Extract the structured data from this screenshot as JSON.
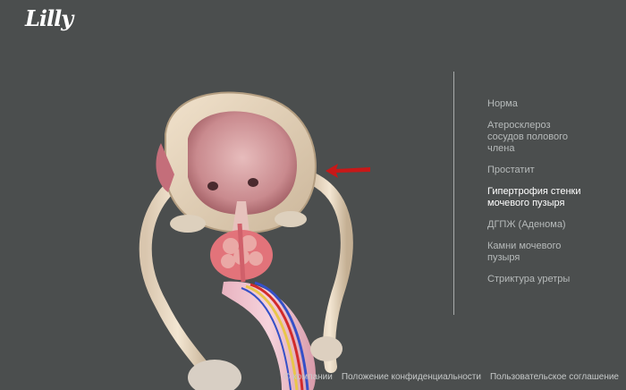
{
  "brand": {
    "logo_text": "Lilly"
  },
  "menu": {
    "items": [
      {
        "label": "Норма",
        "active": false
      },
      {
        "label": "Атеросклероз\nсосудов полового\nчлена",
        "active": false
      },
      {
        "label": "Простатит",
        "active": false
      },
      {
        "label": "Гипертрофия стенки\nмочевого пузыря",
        "active": true
      },
      {
        "label": "ДГПЖ (Аденома)",
        "active": false
      },
      {
        "label": "Камни мочевого\nпузыря",
        "active": false
      },
      {
        "label": "Стриктура уретры",
        "active": false
      }
    ]
  },
  "footer": {
    "links": [
      "© компании",
      "Положение конфиденциальности",
      "Пользовательское соглашение"
    ]
  },
  "colors": {
    "background": "#4b4e4e",
    "menu_text": "#b6baba",
    "menu_active": "#ffffff",
    "arrow": "#c81818"
  },
  "icons": {
    "pointer": "red-arrow-icon"
  }
}
